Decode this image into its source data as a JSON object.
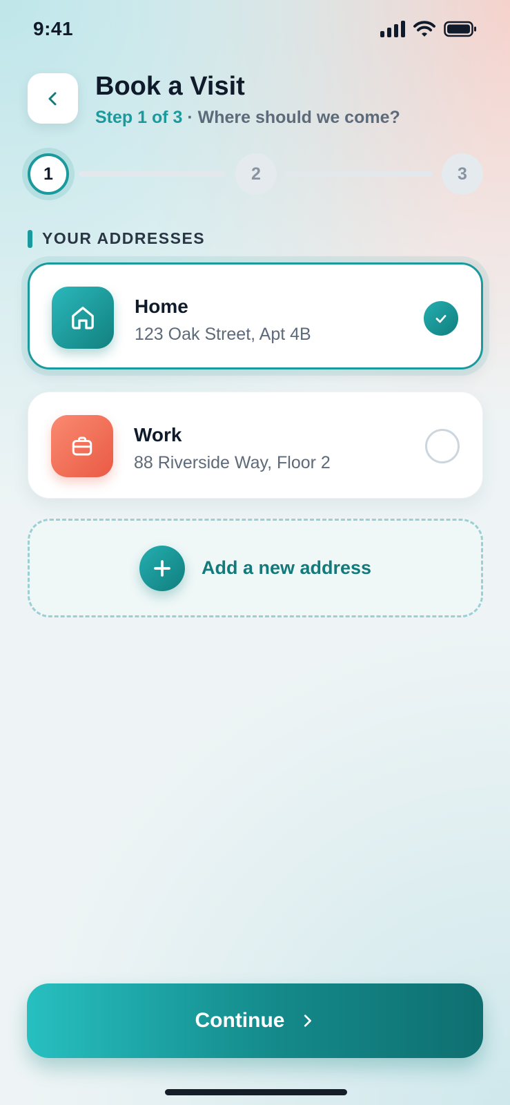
{
  "status_bar": {
    "time": "9:41",
    "icons": [
      "signal-icon",
      "wifi-icon",
      "battery-icon"
    ]
  },
  "header": {
    "back_icon": "chevron-left-icon",
    "title": "Book a Visit",
    "step_label": "Step 1 of 3",
    "separator": " · ",
    "subtitle": "Where should we come?"
  },
  "stepper": {
    "steps": [
      {
        "label": "1",
        "state": "active"
      },
      {
        "label": "2",
        "state": "inactive"
      },
      {
        "label": "3",
        "state": "inactive"
      }
    ]
  },
  "section": {
    "label": "YOUR ADDRESSES"
  },
  "addresses": [
    {
      "name": "Home",
      "address": "123 Oak Street, Apt 4B",
      "icon": "home-icon",
      "selected": true
    },
    {
      "name": "Work",
      "address": "88 Riverside Way, Floor 2",
      "icon": "briefcase-icon",
      "selected": false
    }
  ],
  "add_address": {
    "label": "Add a new address",
    "icon": "plus-icon"
  },
  "continue_button": {
    "label": "Continue",
    "icon": "chevron-right-icon"
  },
  "colors": {
    "accent": "#1b9a9d",
    "accent_dark": "#117e7e",
    "work_accent": "#ea5a44",
    "text_primary": "#0f1b2a",
    "text_secondary": "#5d6a7a"
  }
}
